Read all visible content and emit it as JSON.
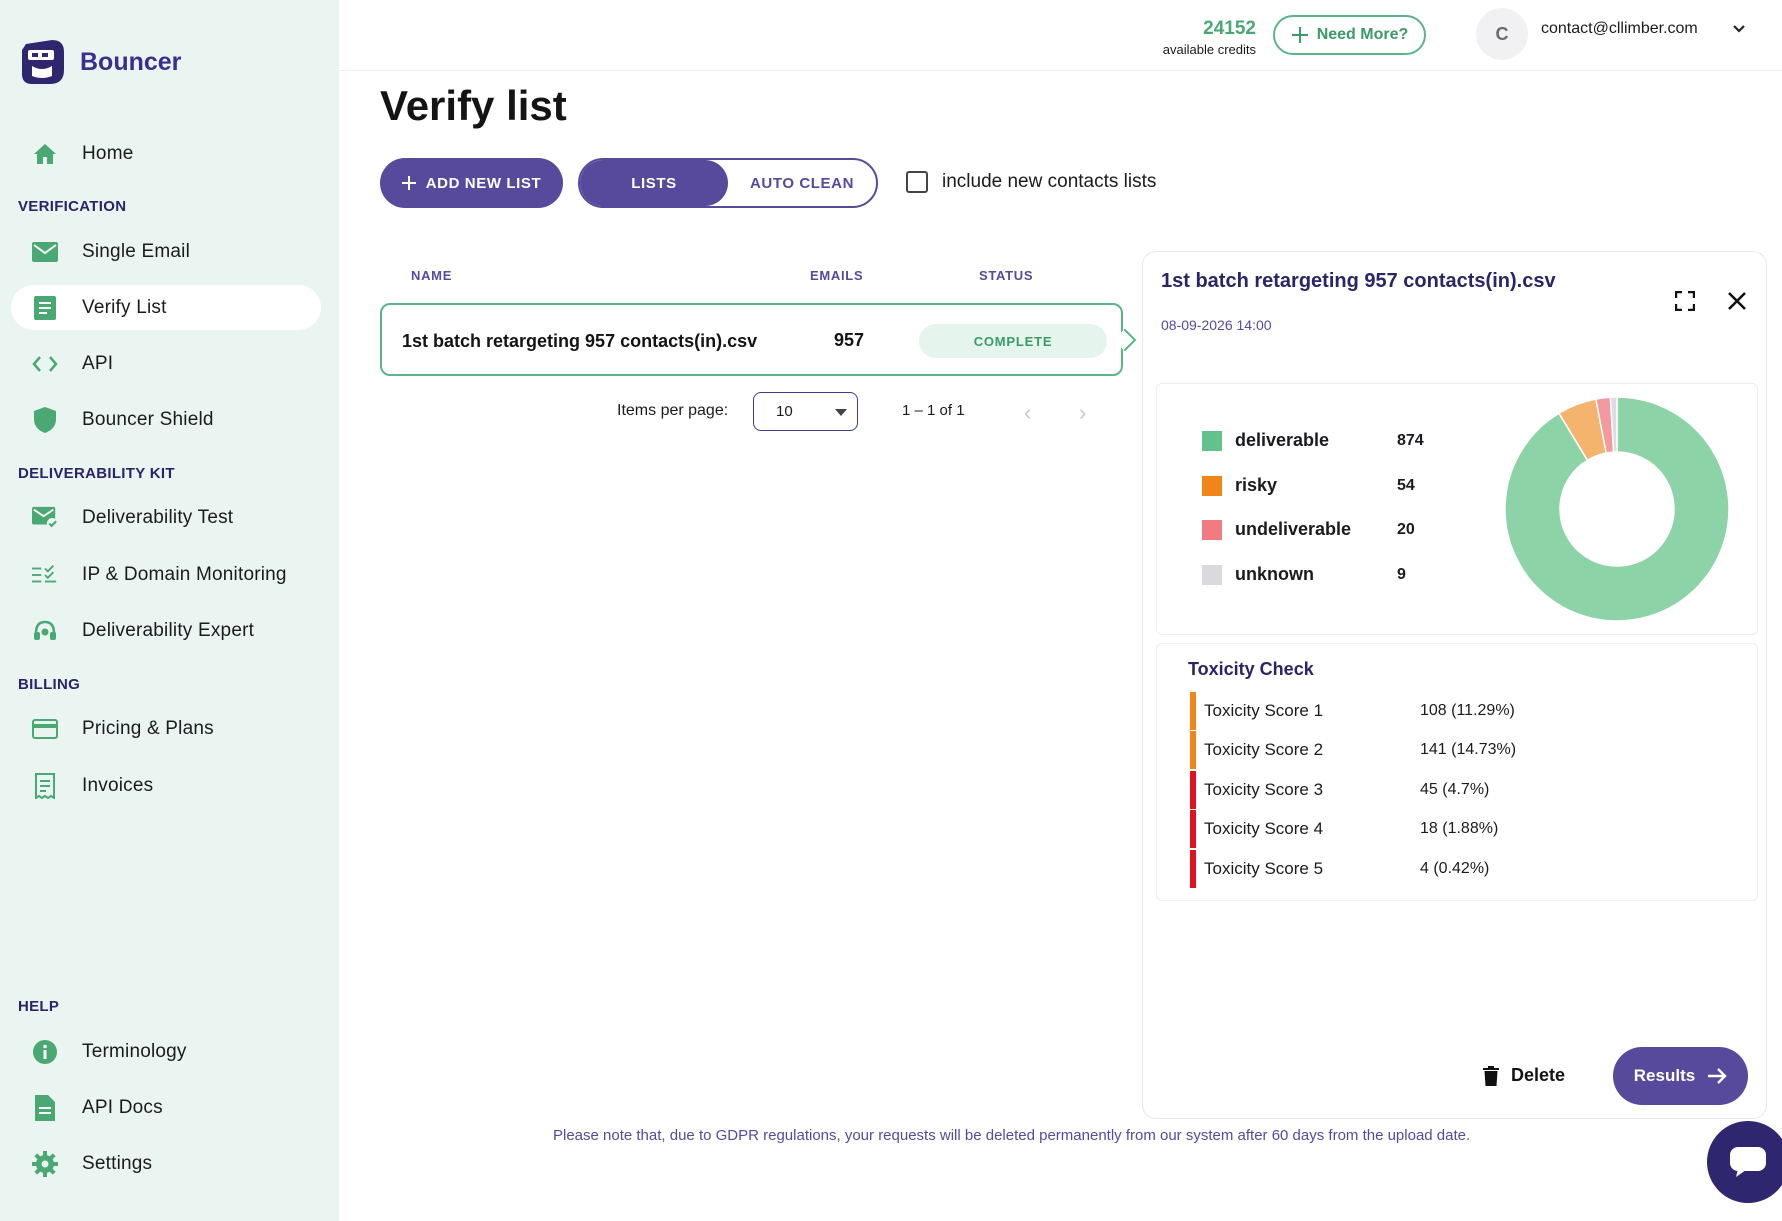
{
  "app": {
    "name": "Bouncer"
  },
  "colors": {
    "accent": "#574a9c",
    "green": "#5ab587",
    "sidebar_bg": "#eaf5f1"
  },
  "sidebar": {
    "home": {
      "label": "Home",
      "icon": "home-icon"
    },
    "sections": {
      "verification": "VERIFICATION",
      "deliverability": "DELIVERABILITY KIT",
      "billing": "BILLING",
      "help": "HELP"
    },
    "items": {
      "single_email": {
        "label": "Single Email",
        "icon": "mail-icon"
      },
      "verify_list": {
        "label": "Verify List",
        "icon": "list-icon"
      },
      "api": {
        "label": "API",
        "icon": "code-icon"
      },
      "shield": {
        "label": "Bouncer Shield",
        "icon": "shield-icon"
      },
      "deliv_test": {
        "label": "Deliverability Test",
        "icon": "mail-check-icon"
      },
      "ip_monitoring": {
        "label": "IP & Domain Monitoring",
        "icon": "checklist-icon"
      },
      "deliv_expert": {
        "label": "Deliverability Expert",
        "icon": "headset-icon"
      },
      "pricing": {
        "label": "Pricing & Plans",
        "icon": "credit-card-icon"
      },
      "invoices": {
        "label": "Invoices",
        "icon": "receipt-icon"
      },
      "terminology": {
        "label": "Terminology",
        "icon": "info-icon"
      },
      "api_docs": {
        "label": "API Docs",
        "icon": "document-icon"
      },
      "settings": {
        "label": "Settings",
        "icon": "gear-icon"
      }
    }
  },
  "topbar": {
    "credits": "24152",
    "credits_label": "available credits",
    "need_more": "Need More?",
    "avatar_initial": "C",
    "email": "contact@cllimber.com"
  },
  "main": {
    "title": "Verify list",
    "add_button": "ADD NEW LIST",
    "toggle": {
      "lists": "LISTS",
      "auto_clean": "AUTO CLEAN",
      "active": "lists"
    },
    "include_new_contacts": "include new contacts lists",
    "table": {
      "headers": {
        "name": "NAME",
        "emails": "EMAILS",
        "status": "STATUS"
      },
      "rows": [
        {
          "name": "1st batch retargeting 957 contacts(in).csv",
          "emails": "957",
          "status": "COMPLETE"
        }
      ]
    },
    "pager": {
      "label": "Items per page:",
      "per_page": "10",
      "range": "1 – 1 of 1"
    }
  },
  "panel": {
    "title": "1st batch retargeting 957 contacts(in).csv",
    "date": "08-09-2026 14:00",
    "results": [
      {
        "label": "deliverable",
        "value": 874,
        "color": "#63c28b",
        "slice_color": "#8dd3a8"
      },
      {
        "label": "risky",
        "value": 54,
        "color": "#f0861a",
        "slice_color": "#f5b46e"
      },
      {
        "label": "undeliverable",
        "value": 20,
        "color": "#f07c82",
        "slice_color": "#f39aa0"
      },
      {
        "label": "unknown",
        "value": 9,
        "color": "#d8dadd",
        "slice_color": "#dcdde0"
      }
    ],
    "toxicity": {
      "title": "Toxicity Check",
      "rows": [
        {
          "label": "Toxicity Score 1",
          "value": "108 (11.29%)",
          "color": "#f0861a"
        },
        {
          "label": "Toxicity Score 2",
          "value": "141 (14.73%)",
          "color": "#f0861a"
        },
        {
          "label": "Toxicity Score 3",
          "value": "45 (4.7%)",
          "color": "#e0121b"
        },
        {
          "label": "Toxicity Score 4",
          "value": "18 (1.88%)",
          "color": "#e0121b"
        },
        {
          "label": "Toxicity Score 5",
          "value": "4 (0.42%)",
          "color": "#e0121b"
        }
      ]
    },
    "delete": "Delete",
    "results_button": "Results"
  },
  "footer": {
    "gdpr": "Please note that, due to GDPR regulations, your requests will be deleted permanently from our system after 60 days from the upload date."
  }
}
